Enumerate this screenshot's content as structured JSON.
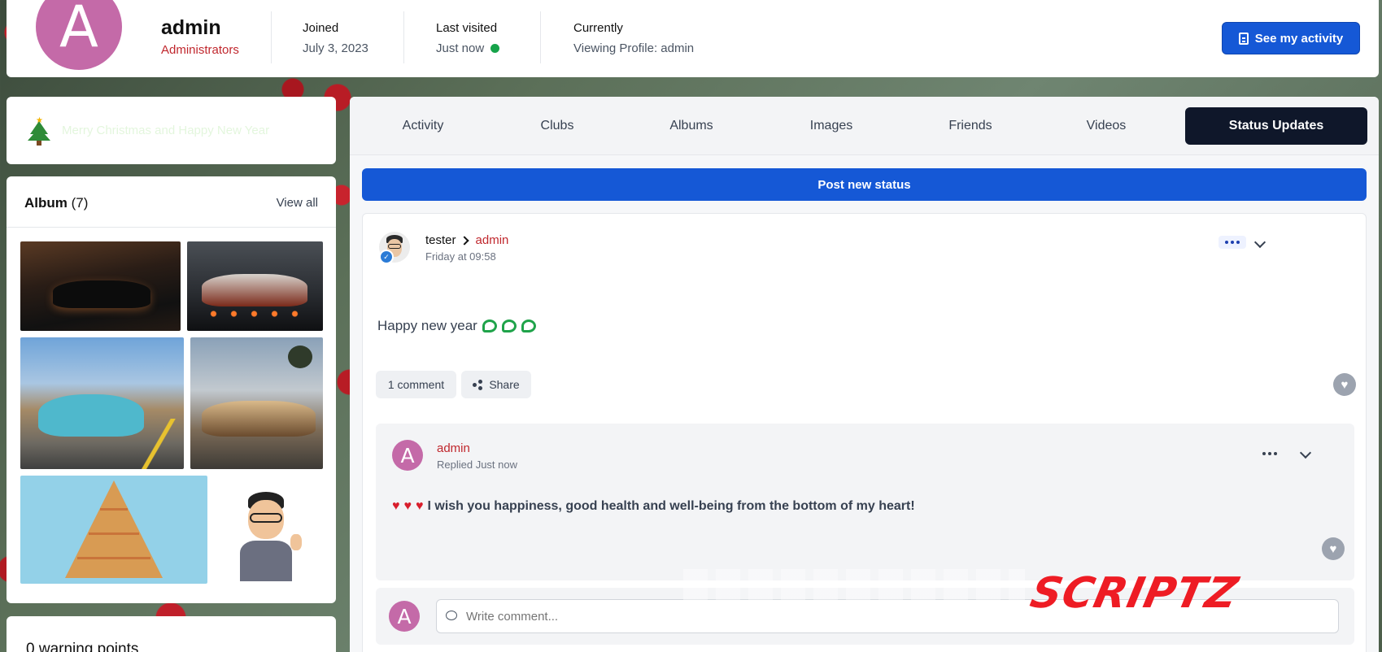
{
  "header": {
    "avatar_letter": "A",
    "username": "admin",
    "role": "Administrators",
    "joined_label": "Joined",
    "joined_value": "July 3, 2023",
    "last_visited_label": "Last visited",
    "last_visited_value": "Just now",
    "currently_label": "Currently",
    "currently_value": "Viewing Profile: admin",
    "activity_button": "See my activity"
  },
  "sidebar": {
    "greeting": "Merry Christmas and Happy New Year",
    "album_title": "Album",
    "album_count": "(7)",
    "album_view_all": "View all",
    "warning_text": "0 warning points"
  },
  "tabs": [
    {
      "label": "Activity"
    },
    {
      "label": "Clubs"
    },
    {
      "label": "Albums"
    },
    {
      "label": "Images"
    },
    {
      "label": "Friends"
    },
    {
      "label": "Videos"
    },
    {
      "label": "Status Updates",
      "active": true
    }
  ],
  "post_new_status": "Post new status",
  "status": {
    "poster": "tester",
    "target": "admin",
    "time": "Friday at 09:58",
    "text": "Happy new year",
    "comment_button": "1 comment",
    "share_button": "Share"
  },
  "reply": {
    "avatar_letter": "A",
    "name": "admin",
    "time": "Replied Just now",
    "text": "I wish you happiness, good health and well-being from the bottom of my heart!"
  },
  "comment": {
    "avatar_letter": "A",
    "placeholder": "Write comment..."
  },
  "watermark": "SCRIPTZ",
  "colors": {
    "primary": "#1558d6",
    "active_tab": "#0f172a",
    "user_link": "#c0272d",
    "online": "#16a34a",
    "avatar": "#c46aa8"
  }
}
